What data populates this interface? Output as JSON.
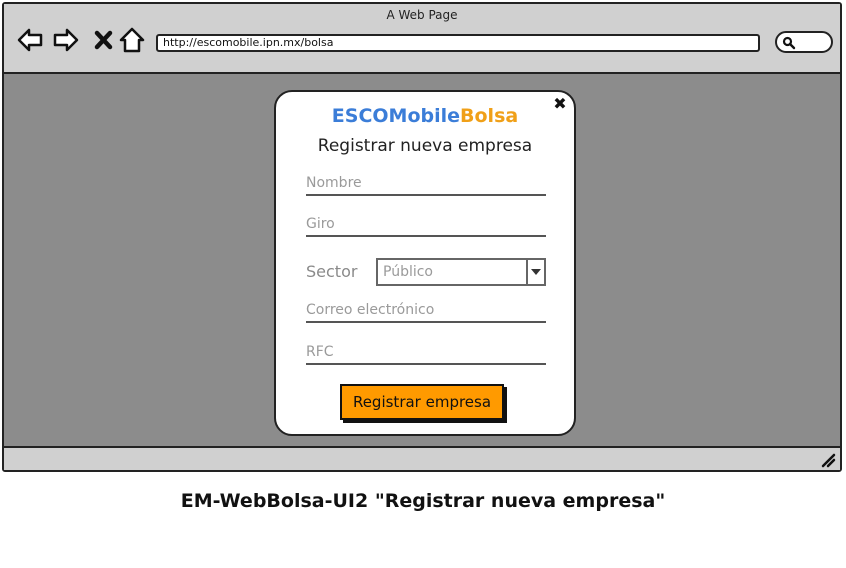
{
  "window": {
    "title": "A Web Page",
    "url": "http://escomobile.ipn.mx/bolsa"
  },
  "toolbar": {
    "icons": [
      "back-arrow-icon",
      "forward-arrow-icon",
      "close-x-icon",
      "home-icon",
      "search-icon",
      "resize-icon"
    ]
  },
  "modal": {
    "brand_part1": "ESCOMobile",
    "brand_part2": "Bolsa",
    "brand_colors": {
      "part1": "#3b7dd8",
      "part2": "#f0a018"
    },
    "title": "Registrar nueva empresa",
    "close_label": "✖",
    "fields": {
      "nombre": {
        "placeholder": "Nombre",
        "value": ""
      },
      "giro": {
        "placeholder": "Giro",
        "value": ""
      },
      "correo": {
        "placeholder": "Correo electrónico",
        "value": ""
      },
      "rfc": {
        "placeholder": "RFC",
        "value": ""
      }
    },
    "sector": {
      "label": "Sector",
      "selected": "Público"
    },
    "submit_label": "Registrar empresa",
    "submit_color": "#ff9a00"
  },
  "caption": "EM-WebBolsa-UI2 \"Registrar nueva empresa\""
}
